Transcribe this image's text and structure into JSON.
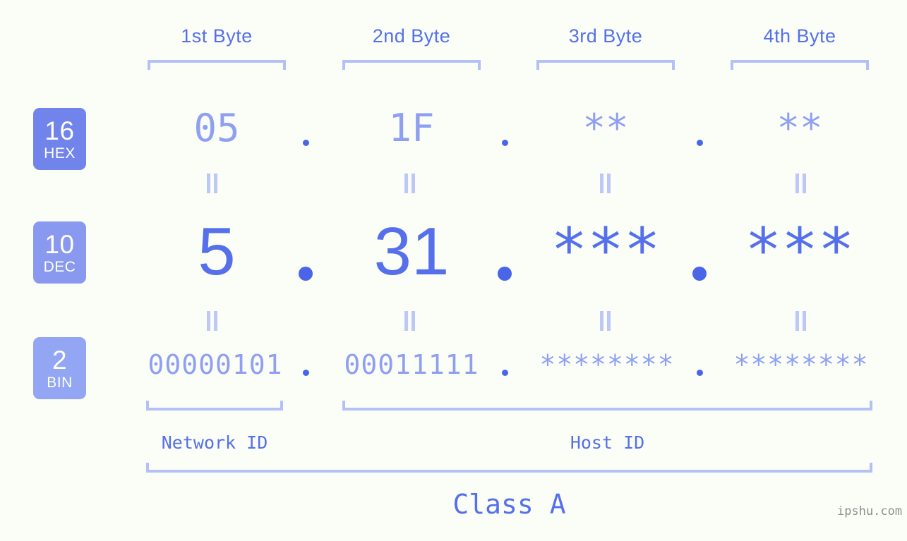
{
  "background_color": "#fbfdf7",
  "accent_color": "#5570ea",
  "accent_light_color": "#8fa0f2",
  "bracket_color": "#b4c1f6",
  "byte_headers": [
    {
      "label": "1st Byte"
    },
    {
      "label": "2nd Byte"
    },
    {
      "label": "3rd Byte"
    },
    {
      "label": "4th Byte"
    }
  ],
  "bases": [
    {
      "number": "16",
      "name": "HEX",
      "color": "#7184ec"
    },
    {
      "number": "10",
      "name": "DEC",
      "color": "#8a99f0"
    },
    {
      "number": "2",
      "name": "BIN",
      "color": "#93a6f4"
    }
  ],
  "rows": {
    "hex": {
      "byte1": "05",
      "byte2": "1F",
      "byte3": "**",
      "byte4": "**"
    },
    "dec": {
      "byte1": "5",
      "byte2": "31",
      "byte3": "***",
      "byte4": "***"
    },
    "bin": {
      "byte1": "00000101",
      "byte2": "00011111",
      "byte3": "********",
      "byte4": "********"
    }
  },
  "separator": ".",
  "equality_symbol": "=",
  "sections": {
    "network_id": "Network ID",
    "host_id": "Host ID",
    "class": "Class A"
  },
  "watermark": "ipshu.com"
}
